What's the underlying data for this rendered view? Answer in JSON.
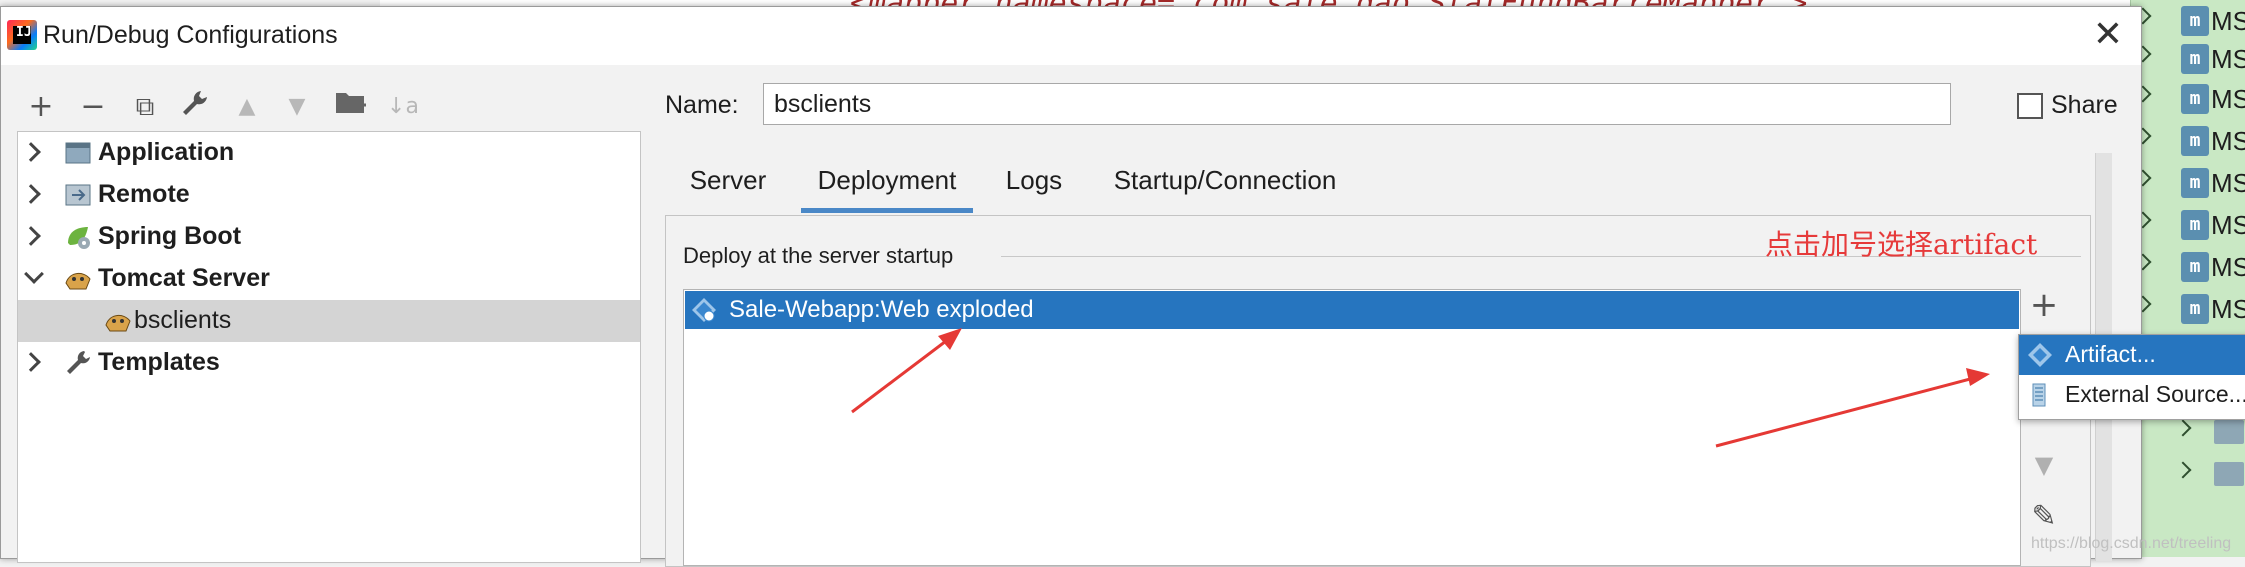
{
  "background": {
    "editor_text": "<mapper namespace=\"com.sale.dao.StatFundBarreMapper\">",
    "project_items": [
      "MS",
      "MS",
      "MS",
      "MS",
      "MS",
      "MS",
      "MS",
      "MS"
    ]
  },
  "dialog": {
    "title": "Run/Debug Configurations",
    "close_glyph": "✕"
  },
  "toolbar": {
    "add": "+",
    "remove": "−",
    "copy": "⧉",
    "edit_defaults": "🔧",
    "move_up": "▲",
    "move_down": "▼",
    "folder": "📁",
    "sort": "↓a"
  },
  "tree": {
    "items": [
      {
        "label": "Application",
        "icon": "application-icon"
      },
      {
        "label": "Remote",
        "icon": "remote-icon"
      },
      {
        "label": "Spring Boot",
        "icon": "spring-boot-icon"
      },
      {
        "label": "Tomcat Server",
        "icon": "tomcat-icon"
      },
      {
        "label": "bsclients",
        "icon": "tomcat-icon"
      },
      {
        "label": "Templates",
        "icon": "wrench-icon"
      }
    ]
  },
  "form": {
    "name_label": "Name:",
    "name_value": "bsclients",
    "share_label": "Share"
  },
  "tabs": [
    "Server",
    "Deployment",
    "Logs",
    "Startup/Connection"
  ],
  "active_tab": "Deployment",
  "deployment": {
    "section_label": "Deploy at the server startup",
    "annotation": "点击加号选择artifact",
    "items": [
      "Sale-Webapp:Web exploded"
    ],
    "side_buttons": {
      "add": "+",
      "down": "▼",
      "edit": "✎"
    }
  },
  "popup": {
    "items": [
      {
        "label": "Artifact...",
        "icon": "artifact-icon"
      },
      {
        "label": "External Source...",
        "icon": "external-source-icon"
      }
    ]
  },
  "watermark": "https://blog.csdn.net/treeling"
}
